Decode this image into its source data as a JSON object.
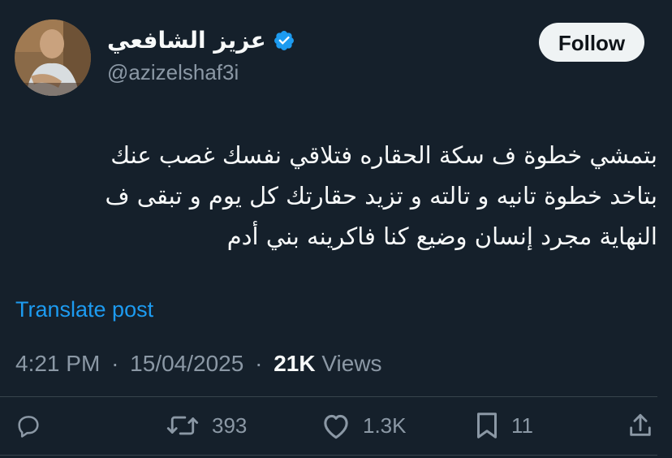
{
  "author": {
    "display_name": "عزيز الشافعي",
    "handle": "@azizelshaf3i",
    "verified_icon": "verified-badge-icon",
    "avatar_icon": "avatar"
  },
  "follow_label": "Follow",
  "tweet": {
    "lines": [
      "بتمشي خطوة ف سكة الحقاره فتلاقي نفسك غصب عنك",
      "بتاخد خطوة تانيه و تالته و تزيد حقارتك كل يوم و تبقى ف",
      "النهاية مجرد إنسان وضيع كنا فاكرينه بني أدم"
    ]
  },
  "translate_label": "Translate post",
  "meta": {
    "time": "4:21 PM",
    "date": "15/04/2025",
    "views_count": "21K",
    "views_label": "Views",
    "separator": "·"
  },
  "actions": {
    "reply": {
      "icon": "reply-icon",
      "count": ""
    },
    "repost": {
      "icon": "repost-icon",
      "count": "393"
    },
    "like": {
      "icon": "heart-icon",
      "count": "1.3K"
    },
    "bookmark": {
      "icon": "bookmark-icon",
      "count": "11"
    },
    "share": {
      "icon": "share-icon",
      "count": ""
    }
  },
  "colors": {
    "background": "#15202b",
    "accent": "#1d9bf0",
    "muted": "#8b98a5",
    "text": "#f7f9f9"
  }
}
